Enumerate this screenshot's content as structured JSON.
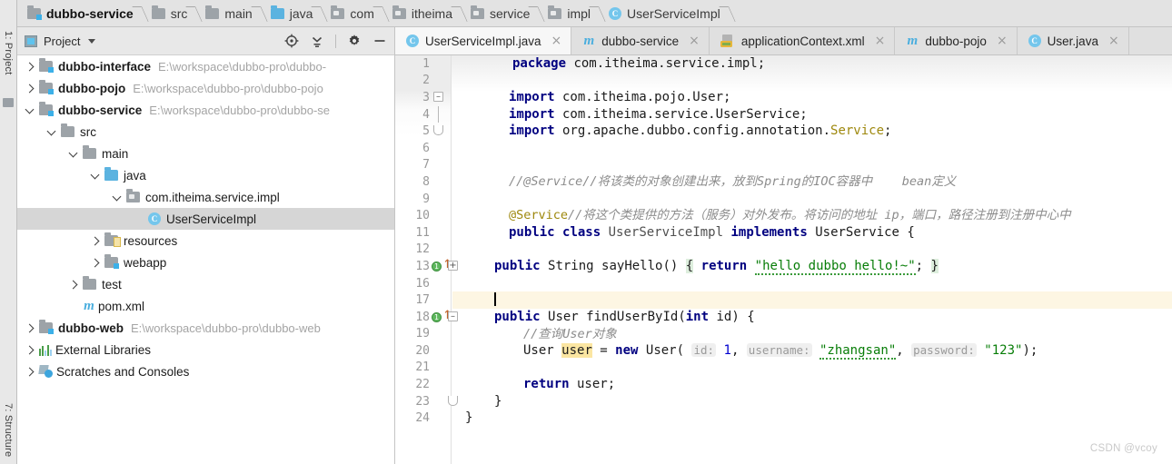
{
  "breadcrumb": {
    "items": [
      {
        "label": "dubbo-service",
        "icon": "folder-module-icon",
        "bold": true
      },
      {
        "label": "src",
        "icon": "folder-icon",
        "bold": false
      },
      {
        "label": "main",
        "icon": "folder-icon",
        "bold": false
      },
      {
        "label": "java",
        "icon": "folder-source-icon",
        "bold": false
      },
      {
        "label": "com",
        "icon": "folder-package-icon",
        "bold": false
      },
      {
        "label": "itheima",
        "icon": "folder-package-icon",
        "bold": false
      },
      {
        "label": "service",
        "icon": "folder-package-icon",
        "bold": false
      },
      {
        "label": "impl",
        "icon": "folder-package-icon",
        "bold": false
      },
      {
        "label": "UserServiceImpl",
        "icon": "java-class-icon",
        "bold": false
      }
    ]
  },
  "left_toolwindows": {
    "top": "1: Project",
    "bottom": "7: Structure"
  },
  "project_panel": {
    "title": "Project",
    "dropdown_icon": "chevron-down-icon",
    "actions": [
      {
        "name": "locate-icon",
        "tooltip": "Select Opened File"
      },
      {
        "name": "collapse-all-icon",
        "tooltip": "Collapse All"
      },
      {
        "name": "gear-icon",
        "tooltip": "Settings"
      },
      {
        "name": "hide-icon",
        "tooltip": "Hide"
      }
    ],
    "tree": [
      {
        "label": "dubbo-interface",
        "path": "E:\\workspace\\dubbo-pro\\dubbo-",
        "indent": 0,
        "arrow": "right",
        "icon": "module-icon",
        "bold": true,
        "selected": false
      },
      {
        "label": "dubbo-pojo",
        "path": "E:\\workspace\\dubbo-pro\\dubbo-pojo",
        "indent": 0,
        "arrow": "right",
        "icon": "module-icon",
        "bold": true,
        "selected": false
      },
      {
        "label": "dubbo-service",
        "path": "E:\\workspace\\dubbo-pro\\dubbo-se",
        "indent": 0,
        "arrow": "down",
        "icon": "module-icon",
        "bold": true,
        "selected": false
      },
      {
        "label": "src",
        "path": "",
        "indent": 1,
        "arrow": "down",
        "icon": "folder-icon",
        "bold": false,
        "selected": false
      },
      {
        "label": "main",
        "path": "",
        "indent": 2,
        "arrow": "down",
        "icon": "folder-icon",
        "bold": false,
        "selected": false
      },
      {
        "label": "java",
        "path": "",
        "indent": 3,
        "arrow": "down",
        "icon": "source-folder-icon",
        "bold": false,
        "selected": false
      },
      {
        "label": "com.itheima.service.impl",
        "path": "",
        "indent": 4,
        "arrow": "down",
        "icon": "package-icon",
        "bold": false,
        "selected": false
      },
      {
        "label": "UserServiceImpl",
        "path": "",
        "indent": 5,
        "arrow": "none",
        "icon": "java-class-icon",
        "bold": false,
        "selected": true
      },
      {
        "label": "resources",
        "path": "",
        "indent": 3,
        "arrow": "right",
        "icon": "resources-folder-icon",
        "bold": false,
        "selected": false
      },
      {
        "label": "webapp",
        "path": "",
        "indent": 3,
        "arrow": "right",
        "icon": "webapp-folder-icon",
        "bold": false,
        "selected": false
      },
      {
        "label": "test",
        "path": "",
        "indent": 2,
        "arrow": "right",
        "icon": "folder-icon",
        "bold": false,
        "selected": false
      },
      {
        "label": "pom.xml",
        "path": "",
        "indent": 2,
        "arrow": "none",
        "icon": "maven-icon",
        "bold": false,
        "selected": false
      },
      {
        "label": "dubbo-web",
        "path": "E:\\workspace\\dubbo-pro\\dubbo-web",
        "indent": 0,
        "arrow": "right",
        "icon": "module-icon",
        "bold": true,
        "selected": false
      },
      {
        "label": "External Libraries",
        "path": "",
        "indent": 0,
        "arrow": "right",
        "icon": "libraries-icon",
        "bold": false,
        "selected": false
      },
      {
        "label": "Scratches and Consoles",
        "path": "",
        "indent": 0,
        "arrow": "right",
        "icon": "scratches-icon",
        "bold": false,
        "selected": false
      }
    ]
  },
  "editor_tabs": [
    {
      "label": "UserServiceImpl.java",
      "icon": "java-class-icon",
      "active": true,
      "close": "×"
    },
    {
      "label": "dubbo-service",
      "icon": "maven-icon",
      "active": false,
      "close": "×"
    },
    {
      "label": "applicationContext.xml",
      "icon": "spring-xml-icon",
      "active": false,
      "close": "×"
    },
    {
      "label": "dubbo-pojo",
      "icon": "maven-icon",
      "active": false,
      "close": "×"
    },
    {
      "label": "User.java",
      "icon": "java-class-icon",
      "active": false,
      "close": "×"
    }
  ],
  "code": {
    "lines": [
      {
        "num": "1",
        "gutter": "",
        "fold": "",
        "current": false
      },
      {
        "num": "2",
        "gutter": "",
        "fold": "",
        "current": false
      },
      {
        "num": "3",
        "gutter": "",
        "fold": "top",
        "current": false
      },
      {
        "num": "4",
        "gutter": "",
        "fold": "",
        "current": false
      },
      {
        "num": "5",
        "gutter": "",
        "fold": "bottom",
        "current": false
      },
      {
        "num": "6",
        "gutter": "",
        "fold": "",
        "current": false
      },
      {
        "num": "7",
        "gutter": "",
        "fold": "",
        "current": false
      },
      {
        "num": "8",
        "gutter": "",
        "fold": "",
        "current": false
      },
      {
        "num": "9",
        "gutter": "",
        "fold": "",
        "current": false
      },
      {
        "num": "10",
        "gutter": "",
        "fold": "",
        "current": false
      },
      {
        "num": "11",
        "gutter": "",
        "fold": "",
        "current": false
      },
      {
        "num": "12",
        "gutter": "",
        "fold": "",
        "current": false
      },
      {
        "num": "13",
        "gutter": "run-override",
        "fold": "collapsed",
        "current": false
      },
      {
        "num": "16",
        "gutter": "",
        "fold": "",
        "current": false
      },
      {
        "num": "17",
        "gutter": "",
        "fold": "",
        "current": true
      },
      {
        "num": "18",
        "gutter": "run-override",
        "fold": "expanded",
        "current": false
      },
      {
        "num": "19",
        "gutter": "",
        "fold": "",
        "current": false
      },
      {
        "num": "20",
        "gutter": "",
        "fold": "",
        "current": false
      },
      {
        "num": "21",
        "gutter": "",
        "fold": "",
        "current": false
      },
      {
        "num": "22",
        "gutter": "",
        "fold": "",
        "current": false
      },
      {
        "num": "23",
        "gutter": "",
        "fold": "end",
        "current": false
      },
      {
        "num": "24",
        "gutter": "",
        "fold": "",
        "current": false
      }
    ],
    "text": {
      "l1_kw": "package",
      "l1_rest": " com.itheima.service.impl;",
      "l3_kw": "import",
      "l3_rest": " com.itheima.pojo.User;",
      "l4_kw": "import",
      "l4_rest": " com.itheima.service.UserService;",
      "l5_kw": "import",
      "l5_rest": " org.apache.dubbo.config.",
      "l5_tail": "annotation.",
      "l5_ann": "Service",
      "l5_semi": ";",
      "l8_comment": "//@Service//将该类的对象创建出来，放到Spring的IOC容器中    bean定义",
      "l10_ann": "@Service",
      "l10_comment": "//将这个类提供的方法（服务）对外发布。将访问的地址 ip，端口，路径注册到注册中心中",
      "l11_kw1": "public",
      "l11_kw2": "class",
      "l11_name": "UserServiceImpl",
      "l11_kw3": "implements",
      "l11_iface": "UserService",
      "l11_brace": "{",
      "l13_kw1": "public",
      "l13_type": "String",
      "l13_method": "sayHello()",
      "l13_open": "{",
      "l13_kw2": "return",
      "l13_str": "\"hello dubbo hello!~\"",
      "l13_semi": ";",
      "l13_close": "}",
      "l18_kw1": "public",
      "l18_type": "User",
      "l18_method": "findUserById(",
      "l18_kw2": "int",
      "l18_param": " id) {",
      "l19_comment": "//查询User对象",
      "l20_type": "User ",
      "l20_var": "user",
      "l20_eq": " = ",
      "l20_new": "new",
      "l20_ctor": " User( ",
      "l20_hint_id": "id:",
      "l20_num": "1",
      "l20_comma1": ", ",
      "l20_hint_user": "username:",
      "l20_str1": "\"zhangsan\"",
      "l20_comma2": ", ",
      "l20_hint_pwd": "password:",
      "l20_str2": "\"123\"",
      "l20_end": ");",
      "l22_kw": "return",
      "l22_rest": " user;",
      "l23_brace": "}",
      "l24_brace": "}"
    }
  },
  "watermark": "CSDN @vcoy",
  "colors": {
    "keyword": "#000080",
    "string": "#077d07",
    "annotation": "#9e880d",
    "comment": "#8c8c8c",
    "number": "#0000d0",
    "selection": "#d6d6d6",
    "current_line": "#fdf6e3",
    "accent": "#5bb3e0"
  }
}
